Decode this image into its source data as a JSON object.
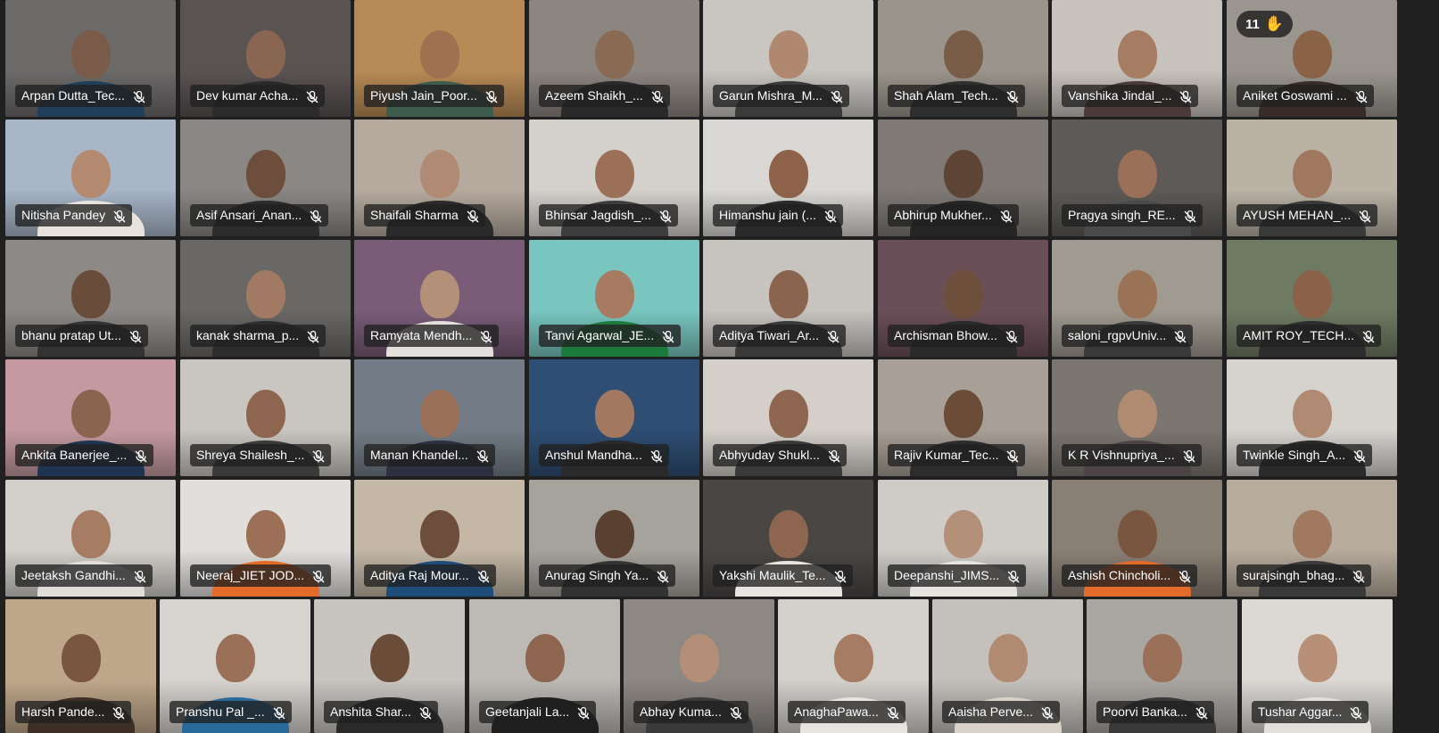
{
  "meeting": {
    "raised_hand_count": "11",
    "hand_icon": "✋",
    "rows": [
      [
        {
          "name": "Arpan Dutta_Tec...",
          "bg": "#6d6a6a",
          "skin": "#7a5a48",
          "shirt": "#1f3f5a"
        },
        {
          "name": "Dev kumar Acha...",
          "bg": "#595352",
          "skin": "#8a6552",
          "shirt": "#2b2b2b"
        },
        {
          "name": "Piyush Jain_Poor...",
          "bg": "#b88a55",
          "skin": "#a07050",
          "shirt": "#3d5c4e"
        },
        {
          "name": "Azeem Shaikh_...",
          "bg": "#8c8580",
          "skin": "#8a6a52",
          "shirt": "#2a2a2a"
        },
        {
          "name": "Garun Mishra_M...",
          "bg": "#c9c6c2",
          "skin": "#b08870",
          "shirt": "#3b3b3b"
        },
        {
          "name": "Shah Alam_Tech...",
          "bg": "#9a948c",
          "skin": "#7a5d48",
          "shirt": "#2f2f2f"
        },
        {
          "name": "Vanshika Jindal_...",
          "bg": "#c8c2bd",
          "skin": "#a67d62",
          "shirt": "#4a3a3a"
        },
        {
          "name": "Aniket Goswami ...",
          "bg": "#9a968f",
          "skin": "#8a6246",
          "shirt": "#3a2b2b"
        }
      ],
      [
        {
          "name": "Nitisha Pandey",
          "bg": "#a8b6c8",
          "skin": "#b48a70",
          "shirt": "#e8e2dd"
        },
        {
          "name": "Asif Ansari_Anan...",
          "bg": "#8a8784",
          "skin": "#6d4e3c",
          "shirt": "#2c2c2c"
        },
        {
          "name": "Shaifali Sharma",
          "bg": "#b6aa9e",
          "skin": "#b08a72",
          "shirt": "#2a2a2a"
        },
        {
          "name": "Bhinsar Jagdish_...",
          "bg": "#d4d0cc",
          "skin": "#9c7058",
          "shirt": "#3d3d3d"
        },
        {
          "name": "Himanshu jain (...",
          "bg": "#d9d7d3",
          "skin": "#8d6248",
          "shirt": "#2a2a2a"
        },
        {
          "name": "Abhirup Mukher...",
          "bg": "#7f7a75",
          "skin": "#5e4434",
          "shirt": "#252525"
        },
        {
          "name": "Pragya singh_RE...",
          "bg": "#5d5a57",
          "skin": "#9a7058",
          "shirt": "#4a4a4a"
        },
        {
          "name": "AYUSH MEHAN_...",
          "bg": "#b9b2a5",
          "skin": "#a07860",
          "shirt": "#3a3a3a"
        }
      ],
      [
        {
          "name": "bhanu pratap Ut...",
          "bg": "#8d8986",
          "skin": "#6a4c3a",
          "shirt": "#333333"
        },
        {
          "name": "kanak sharma_p...",
          "bg": "#6a6866",
          "skin": "#a27a64",
          "shirt": "#2d2d2d"
        },
        {
          "name": "Ramyata Mendh...",
          "bg": "#7a5c78",
          "skin": "#b59078",
          "shirt": "#e3dfdc"
        },
        {
          "name": "Tanvi Agarwal_JE...",
          "bg": "#79c6c0",
          "skin": "#a67b62",
          "shirt": "#1b7a3c"
        },
        {
          "name": "Aditya Tiwari_Ar...",
          "bg": "#c7c3bf",
          "skin": "#8b6450",
          "shirt": "#3a3a3a"
        },
        {
          "name": "Archisman Bhow...",
          "bg": "#6b4f58",
          "skin": "#6d4f3c",
          "shirt": "#2a2a2a"
        },
        {
          "name": "saloni_rgpvUniv...",
          "bg": "#a09a90",
          "skin": "#9a7256",
          "shirt": "#3a3a3a"
        },
        {
          "name": "AMIT ROY_TECH...",
          "bg": "#6f7a63",
          "skin": "#8b6248",
          "shirt": "#2d2d2d"
        }
      ],
      [
        {
          "name": "Ankita Banerjee_...",
          "bg": "#c49aa0",
          "skin": "#8b6450",
          "shirt": "#1f3352"
        },
        {
          "name": "Shreya Shailesh_...",
          "bg": "#c9c5c0",
          "skin": "#8e6650",
          "shirt": "#3a3a3a"
        },
        {
          "name": "Manan Khandel...",
          "bg": "#737c86",
          "skin": "#9a7058",
          "shirt": "#2c3040"
        },
        {
          "name": "Anshul Mandha...",
          "bg": "#2f4e74",
          "skin": "#a27860",
          "shirt": "#2a2a2a"
        },
        {
          "name": "Abhyuday Shukl...",
          "bg": "#d4cfc9",
          "skin": "#8e6650",
          "shirt": "#3a3a3a"
        },
        {
          "name": "Rajiv Kumar_Tec...",
          "bg": "#a89f96",
          "skin": "#6a4c38",
          "shirt": "#2d2d2d"
        },
        {
          "name": "K R Vishnupriya_...",
          "bg": "#7c7670",
          "skin": "#b18a72",
          "shirt": "#4d4545"
        },
        {
          "name": "Twinkle Singh_A...",
          "bg": "#d6d2ce",
          "skin": "#b08a72",
          "shirt": "#2a2a2a"
        }
      ],
      [
        {
          "name": "Jeetaksh Gandhi...",
          "bg": "#d2cfca",
          "skin": "#a67c62",
          "shirt": "#e0dcd8"
        },
        {
          "name": "Neeraj_JIET JOD...",
          "bg": "#e1dedb",
          "skin": "#9c7056",
          "shirt": "#e36b2a"
        },
        {
          "name": "Aditya Raj Mour...",
          "bg": "#c4b7a6",
          "skin": "#6d4e3c",
          "shirt": "#1f4d7a"
        },
        {
          "name": "Anurag Singh Ya...",
          "bg": "#a6a29c",
          "skin": "#5a4030",
          "shirt": "#333333"
        },
        {
          "name": "Yakshi Maulik_Te...",
          "bg": "#4a4644",
          "skin": "#8e6650",
          "shirt": "#e8e4e0"
        },
        {
          "name": "Deepanshi_JIMS...",
          "bg": "#cfccc8",
          "skin": "#b59078",
          "shirt": "#e7e3df"
        },
        {
          "name": "Ashish Chincholi...",
          "bg": "#8a7f74",
          "skin": "#7a5640",
          "shirt": "#e36b2a"
        },
        {
          "name": "surajsingh_bhag...",
          "bg": "#b7ab9c",
          "skin": "#a07860",
          "shirt": "#3a3a3a"
        }
      ],
      [
        {
          "name": "Harsh Pande...",
          "bg": "#bfa78a",
          "skin": "#7a5640",
          "shirt": "#3d2e26"
        },
        {
          "name": "Pranshu Pal _...",
          "bg": "#d7d3cf",
          "skin": "#9a7058",
          "shirt": "#2a6a9a"
        },
        {
          "name": "Anshita Shar...",
          "bg": "#c8c4c0",
          "skin": "#6a4c38",
          "shirt": "#2a2a2a"
        },
        {
          "name": "Geetanjali La...",
          "bg": "#bdb9b5",
          "skin": "#8e6650",
          "shirt": "#1f1f1f"
        },
        {
          "name": "Abhay Kuma...",
          "bg": "#8e8884",
          "skin": "#b58e78",
          "shirt": "#3a3a3a"
        },
        {
          "name": "AnaghaPawa...",
          "bg": "#d4d0cc",
          "skin": "#a67c62",
          "shirt": "#e7e3df"
        },
        {
          "name": "Aaisha Perve...",
          "bg": "#c4c0bb",
          "skin": "#b18a72",
          "shirt": "#d8d2c8"
        },
        {
          "name": "Poorvi Banka...",
          "bg": "#aaa6a2",
          "skin": "#9a7058",
          "shirt": "#3a3a3a"
        },
        {
          "name": "Tushar Aggar...",
          "bg": "#dcd9d5",
          "skin": "#b89078",
          "shirt": "#e3e0dc"
        }
      ]
    ],
    "active_speaker": "Shaifali Sharma",
    "raised_hand_participant": "Aniket Goswami ..."
  }
}
